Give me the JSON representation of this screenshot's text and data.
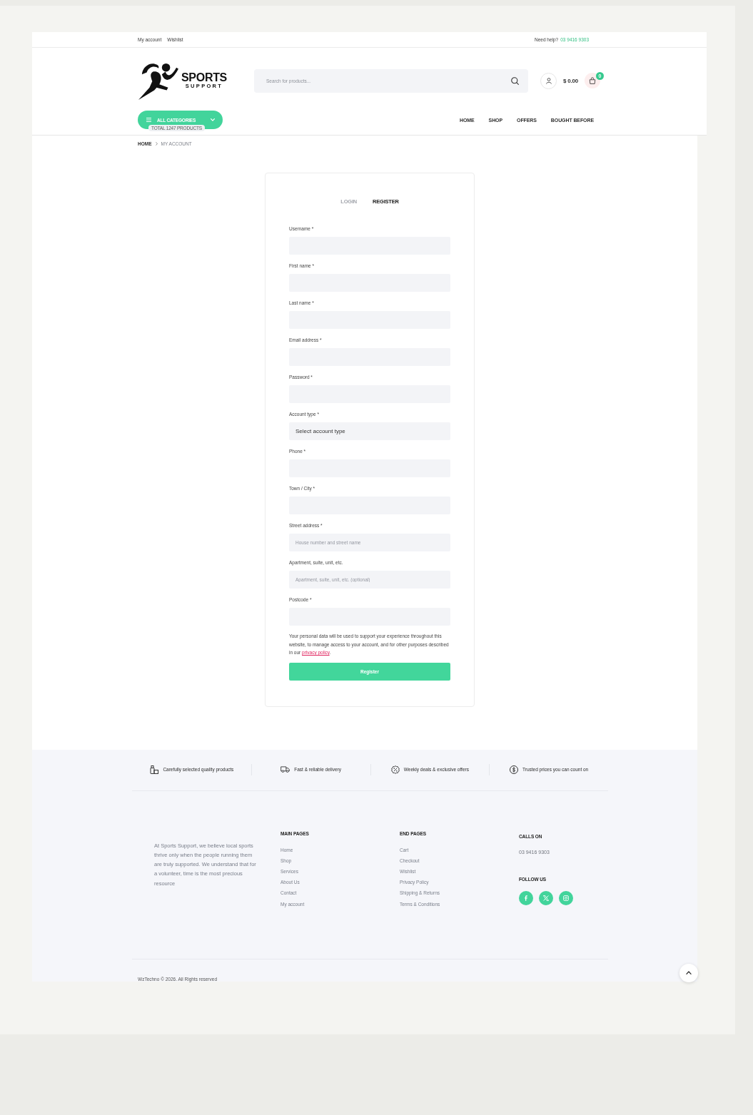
{
  "top_bar": {
    "links": [
      "My account",
      "Wishlist"
    ],
    "help_label": "Need help?",
    "help_phone": "03 9416 9303"
  },
  "header": {
    "logo": {
      "line_1": "SPORTS",
      "line_2": "SUPPORT"
    },
    "search": {
      "placeholder": "Search for products..."
    },
    "cart_total": "$ 0.00",
    "cart_count": "0"
  },
  "nav": {
    "categories_button": "ALL CATEGORIES",
    "product_count": "TOTAL 1247 PRODUCTS",
    "links": [
      "HOME",
      "SHOP",
      "OFFERS",
      "BOUGHT BEFORE"
    ]
  },
  "breadcrumb": [
    "HOME",
    "MY ACCOUNT"
  ],
  "account_form": {
    "tabs": [
      {
        "label": "LOGIN",
        "selected": false
      },
      {
        "label": "REGISTER",
        "selected": true
      }
    ],
    "fields": [
      {
        "kind": "text",
        "label": "Username *"
      },
      {
        "kind": "text",
        "label": "First name *"
      },
      {
        "kind": "text",
        "label": "Last name *"
      },
      {
        "kind": "text",
        "label": "Email address *"
      },
      {
        "kind": "text",
        "label": "Password *"
      },
      {
        "kind": "select",
        "label": "Account type *",
        "value": "Select account type"
      },
      {
        "kind": "text",
        "label": "Phone *"
      },
      {
        "kind": "text",
        "label": "Town / City *"
      },
      {
        "kind": "text",
        "label": "Street address *",
        "placeholder": "House number and street name"
      },
      {
        "kind": "text",
        "label": "Apartment, suite, unit, etc.",
        "placeholder": "Apartment, suite, unit, etc. (optional)"
      },
      {
        "kind": "text",
        "label": "Postcode *"
      }
    ],
    "privacy_text": "Your personal data will be used to support your experience throughout this website, to manage access to your account, and for other purposes described in our",
    "privacy_link": "privacy policy",
    "privacy_end": ".",
    "submit_button": "Register"
  },
  "footer": {
    "features": [
      "Carefully selected quality products",
      "Fast & reliable delivery",
      "Weekly deals & exclusive offers",
      "Trusted prices you can count on"
    ],
    "about": "At Sports Support, we believe local sports thrive only when the people running them are truly supported. We understand that for a volunteer, time is the most precious resource",
    "link_columns": [
      {
        "title": "MAIN PAGES",
        "links": [
          "Home",
          "Shop",
          "Services",
          "About Us",
          "Contact",
          "My account"
        ]
      },
      {
        "title": "END PAGES",
        "links": [
          "Cart",
          "Checkout",
          "Wishlist",
          "Privacy Policy",
          "Shipping & Returns",
          "Terms & Conditions"
        ]
      }
    ],
    "contact": {
      "title": "CALLS ON",
      "phone": "03 9416 9303"
    },
    "social": {
      "title": "FOLLOW US"
    },
    "copyright": "WzTechno © 2026. All Rights reserved"
  }
}
